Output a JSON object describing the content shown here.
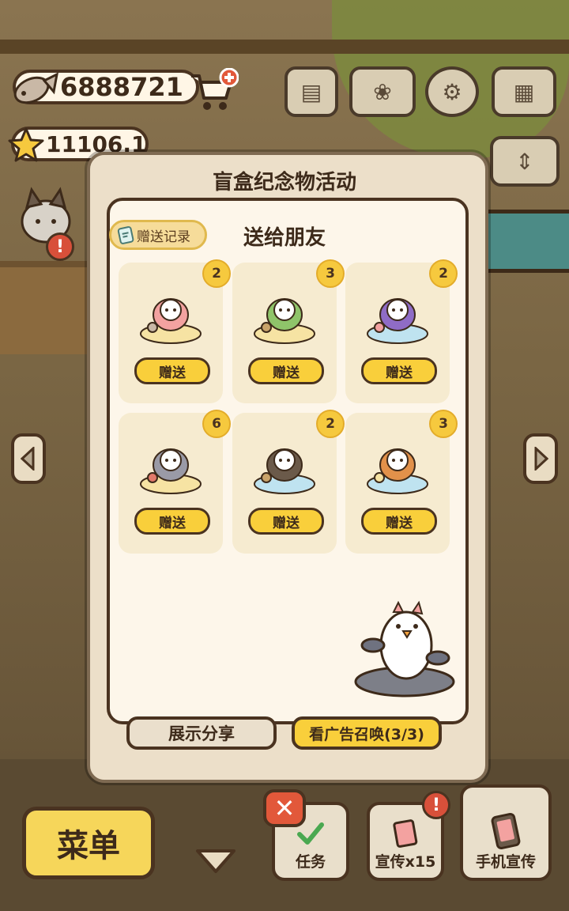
{
  "currency": {
    "fish_amount": "6888721",
    "star_amount": "11106.1",
    "fish_icon": "fish-icon",
    "star_icon": "star-icon",
    "cart_icon": "shop-cart-plus-icon"
  },
  "modal": {
    "title": "盲盒纪念物活动",
    "subtitle": "送给朋友",
    "record_button": "赠送记录",
    "items": [
      {
        "count": "2",
        "give_label": "赠送",
        "figure": "starfish-cat-figure"
      },
      {
        "count": "3",
        "give_label": "赠送",
        "figure": "palm-island-cat-figure"
      },
      {
        "count": "2",
        "give_label": "赠送",
        "figure": "witch-cat-figure"
      },
      {
        "count": "6",
        "give_label": "赠送",
        "figure": "coral-cat-figure"
      },
      {
        "count": "2",
        "give_label": "赠送",
        "figure": "pirate-raccoon-figure"
      },
      {
        "count": "3",
        "give_label": "赠送",
        "figure": "lion-costume-cat-figure"
      }
    ],
    "share_button": "展示分享",
    "ad_button": "看广告召唤(3/3)"
  },
  "bottom_bar": {
    "menu_label": "菜单",
    "task_label": "任务",
    "promo_label": "宣传x15",
    "phone_promo_label": "手机宣传",
    "close_icon": "close-icon"
  },
  "colors": {
    "accent_yellow": "#f9cf3b",
    "badge_yellow": "#f6c93e",
    "panel_cream": "#fdf6ea",
    "outline_brown": "#4a3320",
    "close_red": "#e2583a"
  }
}
